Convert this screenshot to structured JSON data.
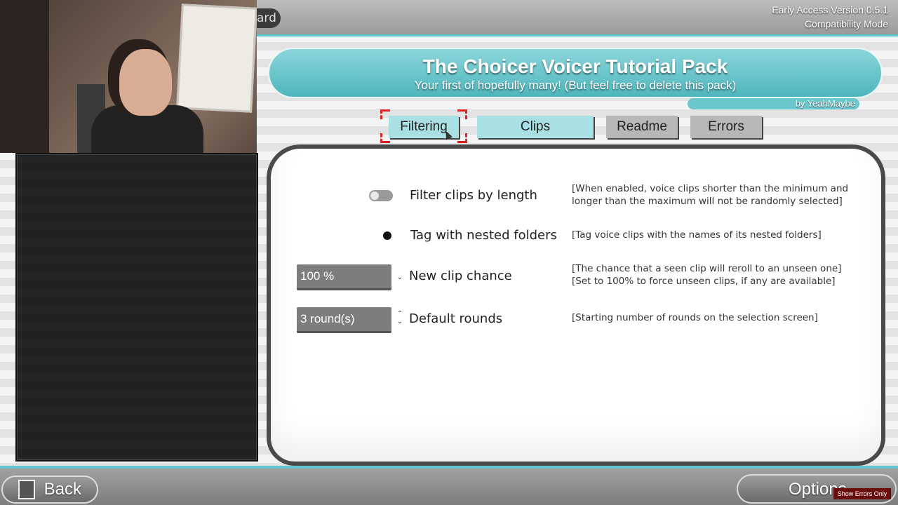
{
  "app": {
    "version_line1": "Early Access Version 0.5.1",
    "version_line2": "Compatibility Mode",
    "top_fragment": "ard"
  },
  "pack": {
    "title": "The Choicer Voicer Tutorial Pack",
    "subtitle": "Your first of hopefully many! (But feel free to delete this pack)",
    "author": "by YeahMaybe"
  },
  "tabs": [
    {
      "label": "Filtering",
      "active": true
    },
    {
      "label": "Clips",
      "active": false
    },
    {
      "label": "Readme",
      "active": false
    },
    {
      "label": "Errors",
      "active": false
    }
  ],
  "settings": {
    "filter_length": {
      "label": "Filter clips by length",
      "enabled": false,
      "desc_line1": "[When enabled, voice clips shorter than the minimum and",
      "desc_line2": "longer than the maximum will not be randomly selected]"
    },
    "nested_folders": {
      "label": "Tag with nested folders",
      "enabled": true,
      "desc_line1": "[Tag voice clips with the names of its nested folders]"
    },
    "new_clip_chance": {
      "label": "New clip chance",
      "value": "100 %",
      "desc_line1": "[The chance that a seen clip will reroll to an unseen one]",
      "desc_line2": "[Set to 100% to force unseen clips, if any are available]"
    },
    "default_rounds": {
      "label": "Default rounds",
      "value": "3 round(s)",
      "desc_line1": "[Starting number of rounds on the selection screen]"
    }
  },
  "footer": {
    "back_label": "Back",
    "options_label": "Options",
    "show_errors_label": "Show Errors Only"
  },
  "colors": {
    "accent": "#5fc6cc",
    "tab_active": "#a8e0e4",
    "tab_inactive": "#b8b8b8"
  }
}
